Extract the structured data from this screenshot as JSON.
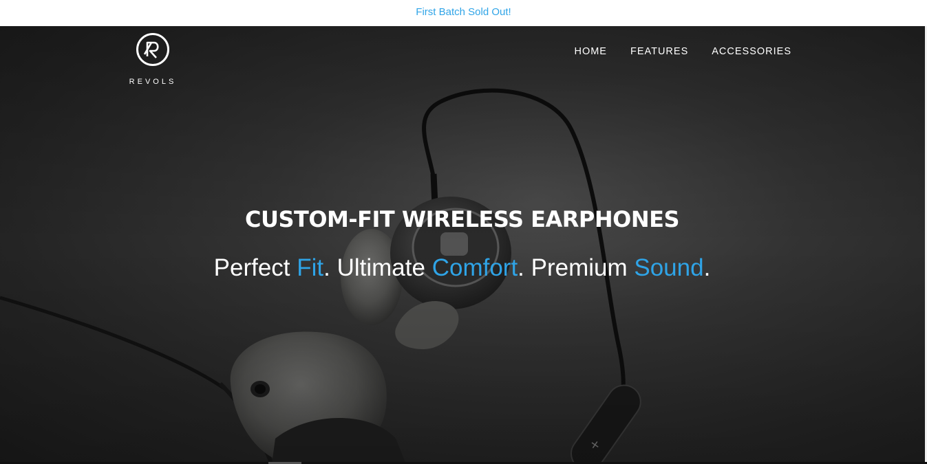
{
  "announcement": {
    "text": "First Batch Sold Out!"
  },
  "brand": {
    "name": "REVOLS",
    "logo_icon": "revols-r-logo-icon"
  },
  "nav": {
    "items": [
      {
        "label": "HOME"
      },
      {
        "label": "FEATURES"
      },
      {
        "label": "ACCESSORIES"
      }
    ]
  },
  "hero": {
    "headline": "CUSTOM-FIT WIRELESS EARPHONES",
    "tagline": {
      "part1": "Perfect ",
      "accent1": "Fit",
      "part2": ". Ultimate ",
      "accent2": "Comfort",
      "part3": ". Premium ",
      "accent3": "Sound",
      "part4": "."
    },
    "image": "wireless-earphones-photo"
  },
  "colors": {
    "accent": "#2fa4e7",
    "hero_background": "#2a2a2a",
    "text_light": "#ffffff"
  }
}
